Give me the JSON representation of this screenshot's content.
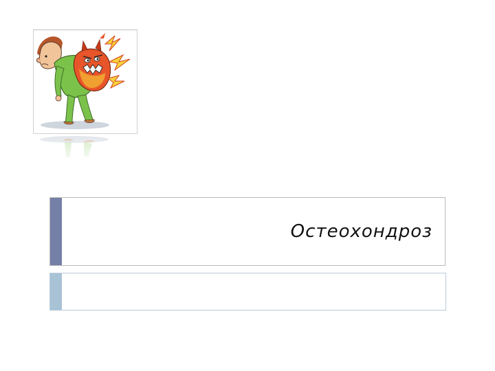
{
  "slide": {
    "title": "Остеохондроз",
    "subtitle": ""
  },
  "illustration": {
    "icon": "back-pain-monster-cartoon-icon"
  },
  "colors": {
    "title_accent": "#7580a8",
    "subtitle_accent": "#a8c2d6"
  }
}
